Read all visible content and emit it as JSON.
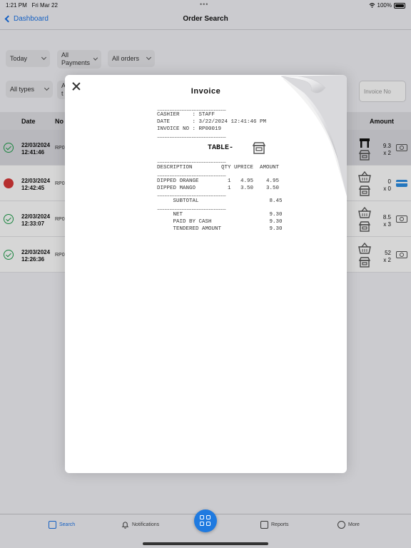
{
  "status_bar": {
    "time": "1:21 PM",
    "date": "Fri Mar 22",
    "battery": "100%"
  },
  "nav": {
    "back_label": "Dashboard",
    "title": "Order Search"
  },
  "filters": {
    "period": "Today",
    "payments_line1": "All",
    "payments_line2": "Payments",
    "orders": "All orders",
    "types": "All types",
    "partial": "A",
    "partial2": "t",
    "invoice_placeholder": "Invoice No"
  },
  "table": {
    "headers": {
      "date": "Date",
      "no": "No",
      "amount": "Amount"
    },
    "rows": [
      {
        "date": "22/03/2024",
        "time": "12:41:46",
        "no": "RP0",
        "amount": "9.3",
        "qty": "x 2",
        "status": "ok",
        "payment": "cash",
        "type_icon": "table-icon",
        "selected": true
      },
      {
        "date": "22/03/2024",
        "time": "12:42:45",
        "no": "RP0",
        "amount": "0",
        "qty": "x 0",
        "status": "error",
        "payment": "card",
        "type_icon": "basket-icon",
        "selected": false
      },
      {
        "date": "22/03/2024",
        "time": "12:33:07",
        "no": "RP0",
        "amount": "8.5",
        "qty": "x 3",
        "status": "ok",
        "payment": "cash",
        "type_icon": "basket-icon",
        "selected": false
      },
      {
        "date": "22/03/2024",
        "time": "12:26:36",
        "no": "RP0",
        "amount": "52",
        "qty": "x 2",
        "status": "ok",
        "payment": "cash",
        "type_icon": "basket-icon",
        "selected": false
      }
    ]
  },
  "invoice": {
    "title": "Invoice",
    "cashier": "CASHIER    : STAFF",
    "date": "DATE       : 3/22/2024 12:41:46 PM",
    "invoice_no": "INVOICE NO : RP00019",
    "table_label": "TABLE-",
    "col_header": "DESCRIPTION         QTY UPRICE  AMOUNT",
    "items": [
      "DIPPED ORANGE         1   4.95    4.95",
      "DIPPED MANGO          1   3.50    3.50"
    ],
    "subtotal": "     SUBTOTAL                      8.45",
    "net": "     NET                           9.30",
    "paid": "     PAID BY CASH                  9.30",
    "tendered": "     TENDERED AMOUNT               9.30"
  },
  "tabs": [
    {
      "label": "Search",
      "active": true
    },
    {
      "label": "Notifications",
      "active": false
    },
    {
      "label": "Reports",
      "active": false
    },
    {
      "label": "More",
      "active": false
    }
  ],
  "colors": {
    "accent": "#1a73e8",
    "success": "#1e9e4a",
    "error": "#d93838"
  }
}
